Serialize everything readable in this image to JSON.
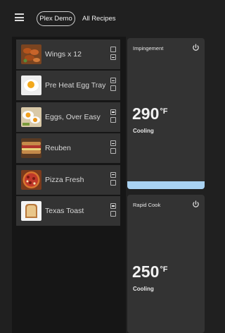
{
  "header": {
    "store_name": "Plex Demo",
    "recipes_label": "All Recipes"
  },
  "recipes": [
    {
      "name": "Wings x 12",
      "thumb": "wings",
      "slots": [
        false,
        true
      ]
    },
    {
      "name": "Pre Heat Egg Tray",
      "thumb": "egg",
      "slots": [
        true,
        false
      ]
    },
    {
      "name": "Eggs, Over Easy",
      "thumb": "eggs",
      "slots": [
        true,
        false
      ]
    },
    {
      "name": "Reuben",
      "thumb": "sandwich",
      "slots": [
        true,
        false
      ]
    },
    {
      "name": "Pizza  Fresh",
      "thumb": "pizza",
      "slots": [
        true,
        false
      ]
    },
    {
      "name": "Texas Toast",
      "thumb": "toast",
      "slots": [
        true,
        false
      ]
    }
  ],
  "ovens": [
    {
      "name": "Impingement",
      "temp": "290",
      "unit": "°F",
      "status": "Cooling",
      "heat_bar": true
    },
    {
      "name": "Rapid Cook",
      "temp": "250",
      "unit": "°F",
      "status": "Cooling",
      "heat_bar": false
    }
  ],
  "colors": {
    "background": "#202020",
    "panel": "#161616",
    "card": "#333333",
    "heat_bar": "#a9d2f2"
  }
}
